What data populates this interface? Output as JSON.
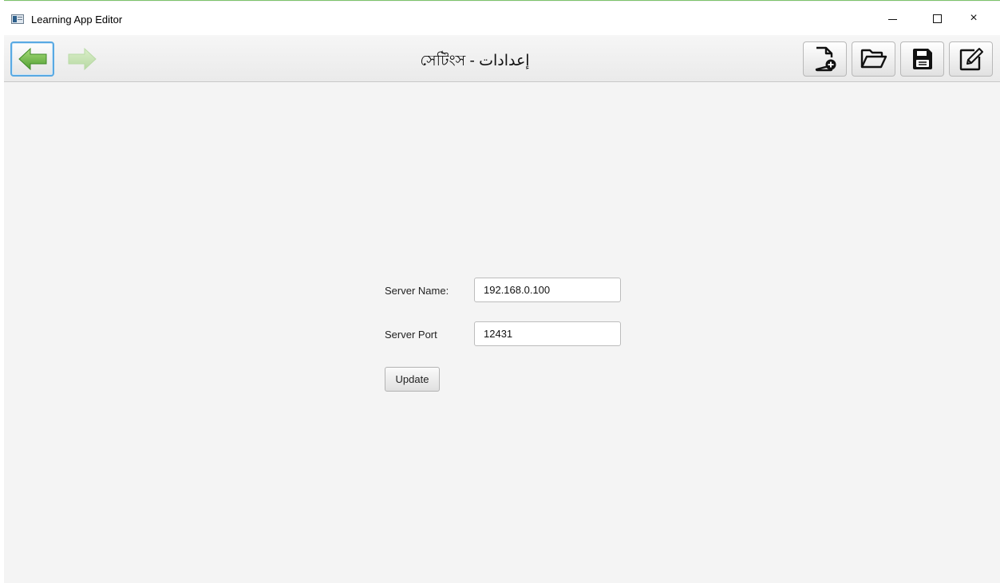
{
  "window": {
    "title": "Learning App Editor",
    "controls": {
      "minimize": "−",
      "maximize": "□",
      "close": "×"
    }
  },
  "toolbar": {
    "page_title": "সেটিংস - إعدادات",
    "nav": {
      "back_icon": "arrow-left-icon",
      "forward_icon": "arrow-right-icon"
    },
    "buttons": [
      {
        "icon": "new-file-icon"
      },
      {
        "icon": "open-folder-icon"
      },
      {
        "icon": "save-icon"
      },
      {
        "icon": "edit-icon"
      }
    ]
  },
  "form": {
    "server_name": {
      "label": "Server Name:",
      "value": "192.168.0.100"
    },
    "server_port": {
      "label": "Server Port",
      "value": "12431"
    },
    "update_label": "Update"
  },
  "colors": {
    "accent": "#58a9e3",
    "arrow_green": "#6fbf4b",
    "window_border": "#7dc36b",
    "background": "#f4f4f4"
  }
}
